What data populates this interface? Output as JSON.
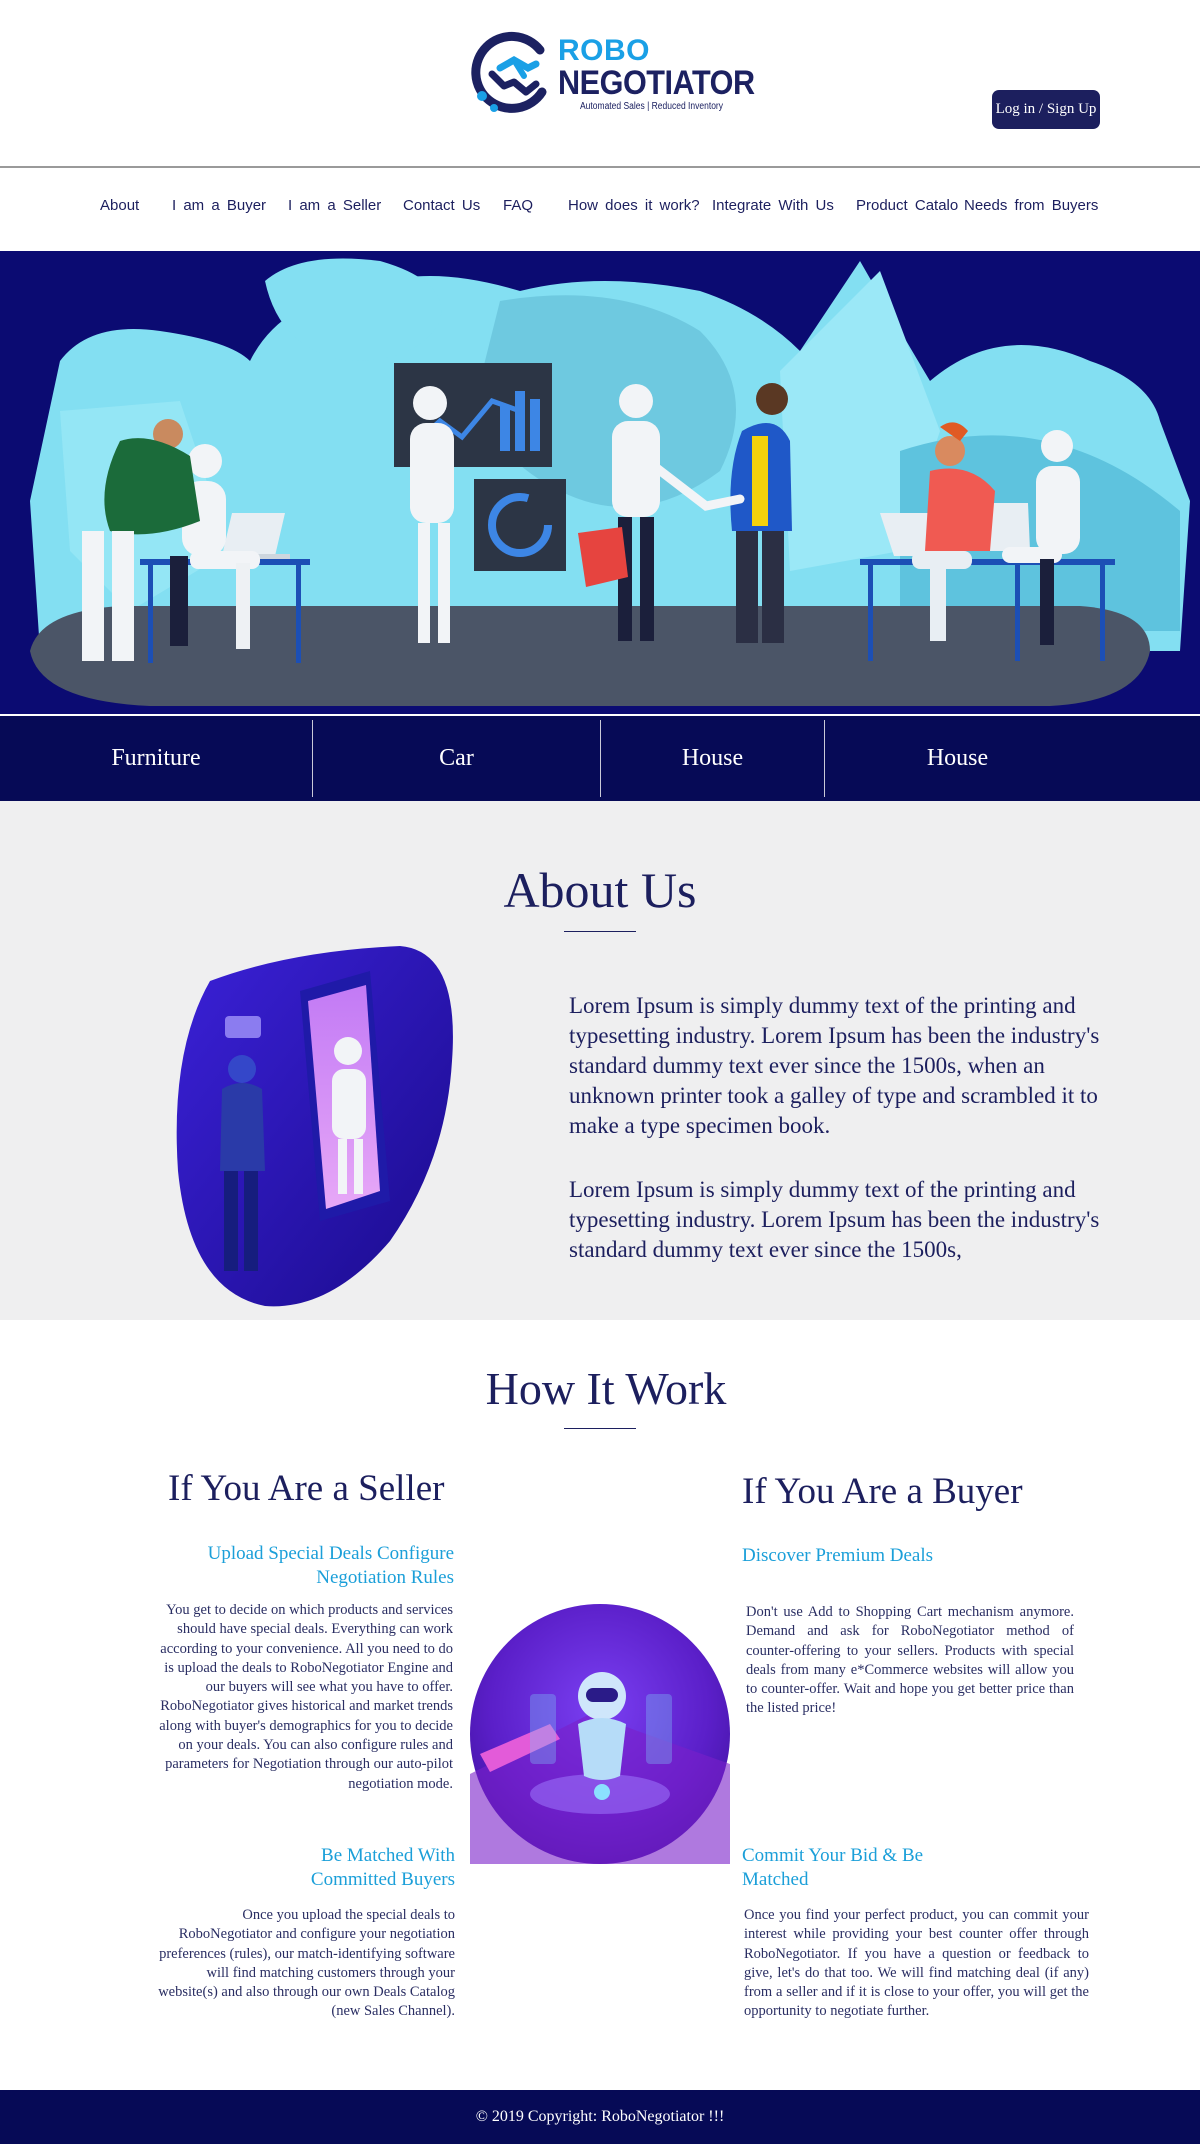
{
  "brand": {
    "name_top": "ROBO",
    "name_bottom": "NEGOTIATOR",
    "tagline": "Automated Sales | Reduced Inventory"
  },
  "header": {
    "login_label": "Log in / Sign Up"
  },
  "nav": {
    "items": [
      {
        "label": "About"
      },
      {
        "label": "I am a Buyer"
      },
      {
        "label": "I am a Seller"
      },
      {
        "label": "Contact Us"
      },
      {
        "label": "FAQ"
      },
      {
        "label": "How does it work?"
      },
      {
        "label": "Integrate With Us"
      },
      {
        "label": "Product Catalo"
      },
      {
        "label": "Needs from Buyers"
      }
    ]
  },
  "categories": [
    {
      "label": "Furniture"
    },
    {
      "label": "Car"
    },
    {
      "label": "House"
    },
    {
      "label": "House"
    }
  ],
  "about": {
    "title": "About Us",
    "paragraph_1": "Lorem Ipsum is simply dummy text of the printing and typesetting industry. Lorem Ipsum has been the industry's standard dummy text ever since the 1500s, when an unknown printer took a galley of type and scrambled it to make a type specimen book.",
    "paragraph_2": "Lorem Ipsum is simply dummy text of the printing and typesetting industry. Lorem Ipsum has been the industry's standard dummy text ever since the 1500s,"
  },
  "how": {
    "title": "How It Work",
    "seller": {
      "heading": "If You Are a Seller",
      "step1_title": "Upload Special Deals Configure Negotiation Rules",
      "step1_text": "You get to decide on which products and services should have special deals. Everything can work according to your convenience. All you need to do is upload the deals to RoboNegotiator Engine and our buyers will see what you have to offer. RoboNegotiator gives historical and market trends along with buyer's demographics for you to decide on your deals. You can also configure rules and parameters for Negotiation through our auto-pilot negotiation mode.",
      "step2_title": "Be Matched With Committed Buyers",
      "step2_text": "Once you upload the special deals to RoboNegotiator and configure your negotiation preferences (rules), our match-identifying software will find matching customers through your website(s) and also through our own Deals Catalog (new Sales Channel)."
    },
    "buyer": {
      "heading": "If You Are a Buyer",
      "step1_title": "Discover Premium Deals",
      "step1_text": "Don't use Add to Shopping Cart mechanism anymore. Demand and ask for RoboNegotiator method of counter-offering to your sellers. Products with special deals from many e*Commerce websites will allow you to counter-offer. Wait and hope you get better price than the listed price!",
      "step2_title": "Commit Your Bid & Be Matched",
      "step2_text": "Once you find your perfect product, you can commit your interest while providing your best counter offer through RoboNegotiator. If you have a question or feedback to give, let's do that too. We will find matching deal (if any) from a seller and if it is close to your offer, you will get the opportunity to negotiate further."
    }
  },
  "footer": {
    "copyright": "© 2019 Copyright: RoboNegotiator !!!"
  },
  "colors": {
    "navy": "#1c1f5e",
    "dark_band": "#060a56",
    "hero_bg": "#0b0b72",
    "accent_blue": "#1b9fd9",
    "about_bg": "#efeff0"
  }
}
